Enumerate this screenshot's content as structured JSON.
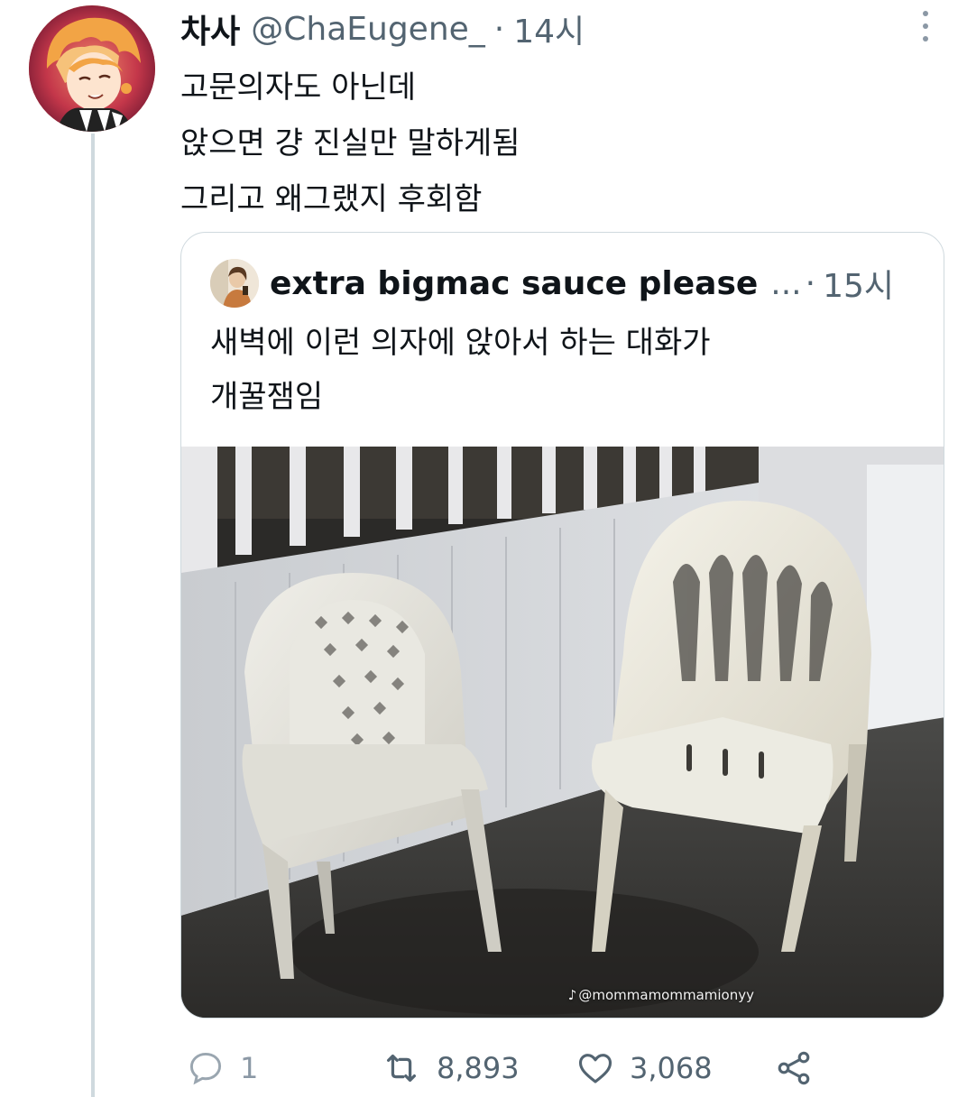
{
  "tweet": {
    "display_name": "차사",
    "handle": "@ChaEugene_",
    "separator": "·",
    "time": "14시",
    "text_lines": [
      "고문의자도 아닌데",
      "앉으면 걍 진실만 말하게됨",
      "그리고 왜그랬지 후회함"
    ]
  },
  "quote": {
    "display_name": "extra bigmac sauce please",
    "ellipsis": "...",
    "separator": "·",
    "time": "15시",
    "text_lines": [
      "새벽에 이런 의자에 앉아서 하는 대화가",
      "개꿀잼임"
    ],
    "image_watermark": "@mommamommamionyy",
    "image_watermark_logo": "♪"
  },
  "actions": {
    "reply_count": "1",
    "retweet_count": "8,893",
    "like_count": "3,068"
  },
  "icons": {
    "more": "more-vertical-icon",
    "reply": "reply-bubble-icon",
    "retweet": "retweet-icon",
    "like": "heart-icon",
    "share": "share-icon"
  },
  "colors": {
    "text_primary": "#0f1419",
    "text_secondary": "#536471",
    "border": "#cfd9de"
  }
}
